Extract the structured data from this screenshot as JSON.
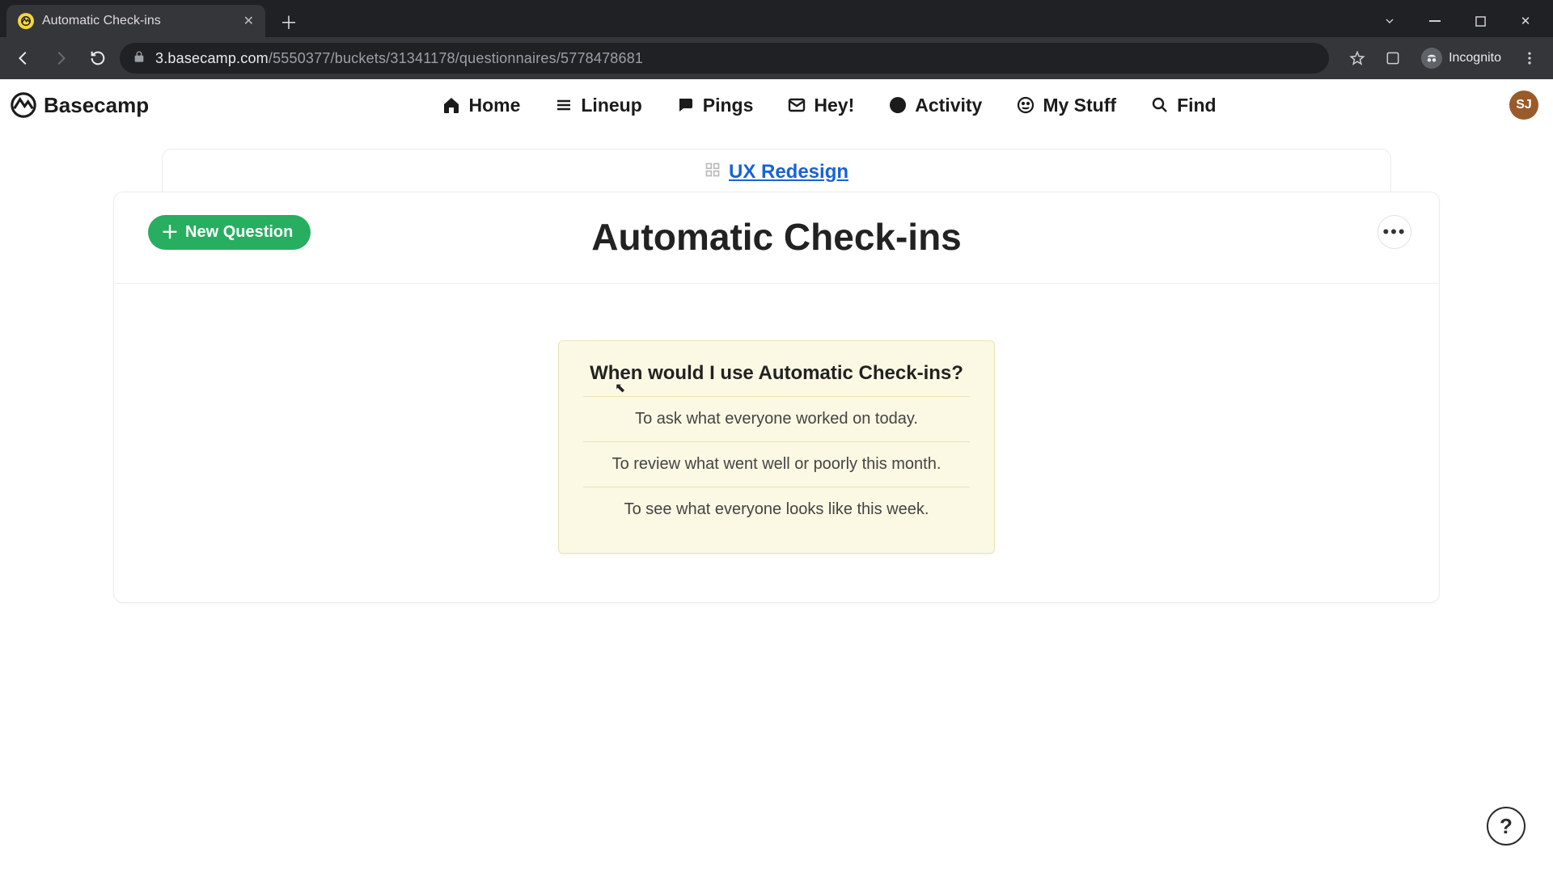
{
  "browser": {
    "tab_title": "Automatic Check-ins",
    "url_host": "3.basecamp.com",
    "url_path": "/5550377/buckets/31341178/questionnaires/5778478681",
    "incognito_label": "Incognito"
  },
  "nav": {
    "brand": "Basecamp",
    "links": {
      "home": "Home",
      "lineup": "Lineup",
      "pings": "Pings",
      "hey": "Hey!",
      "activity": "Activity",
      "mystuff": "My Stuff",
      "find": "Find"
    },
    "avatar_initials": "SJ"
  },
  "breadcrumb": {
    "project": "UX Redesign"
  },
  "page": {
    "new_question_label": "New Question",
    "title": "Automatic Check-ins",
    "tip": {
      "heading": "When would I use Automatic Check-ins?",
      "rows": [
        "To ask what everyone worked on today.",
        "To review what went well or poorly this month.",
        "To see what everyone looks like this week."
      ]
    },
    "help_label": "?"
  }
}
